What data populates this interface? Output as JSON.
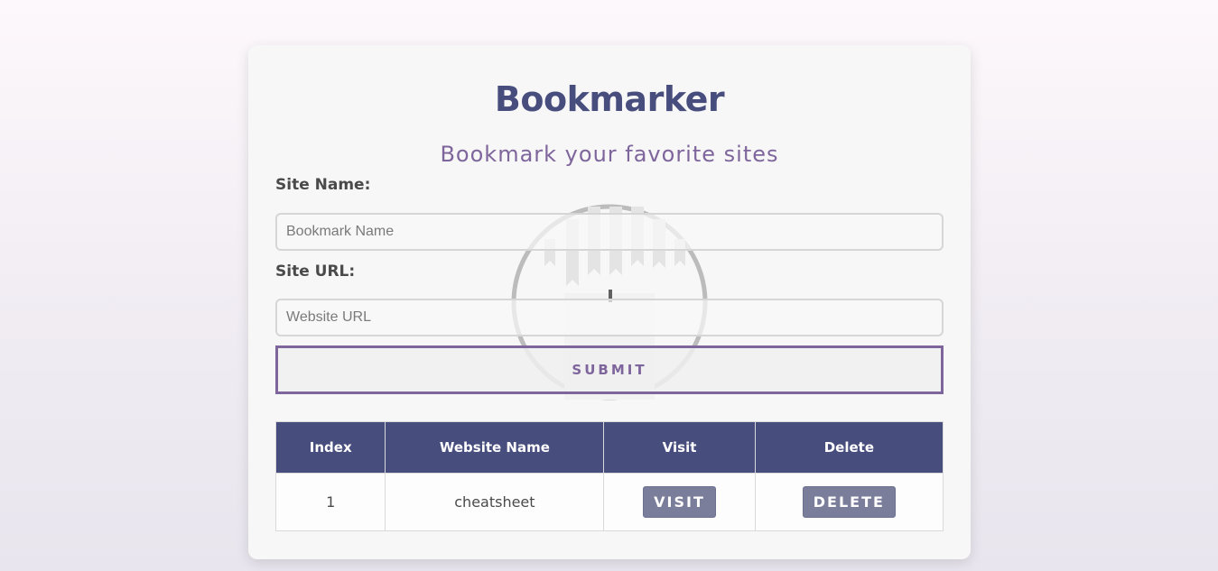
{
  "app": {
    "title": "Bookmarker",
    "subtitle": "Bookmark your favorite sites"
  },
  "form": {
    "site_name_label": "Site Name:",
    "site_name_placeholder": "Bookmark Name",
    "site_name_value": "",
    "site_url_label": "Site URL:",
    "site_url_placeholder": "Website URL",
    "site_url_value": "",
    "submit_label": "SUBMIT"
  },
  "table": {
    "headers": [
      "Index",
      "Website Name",
      "Visit",
      "Delete"
    ],
    "rows": [
      {
        "index": "1",
        "name": "cheatsheet",
        "visit_label": "VISIT",
        "delete_label": "DELETE"
      }
    ]
  },
  "icons": {
    "watermark": "bookmark-clock-icon"
  },
  "colors": {
    "primary": "#474d7d",
    "accent": "#7e659c",
    "button": "#7a7e9a",
    "card": "#f7f7f7"
  }
}
